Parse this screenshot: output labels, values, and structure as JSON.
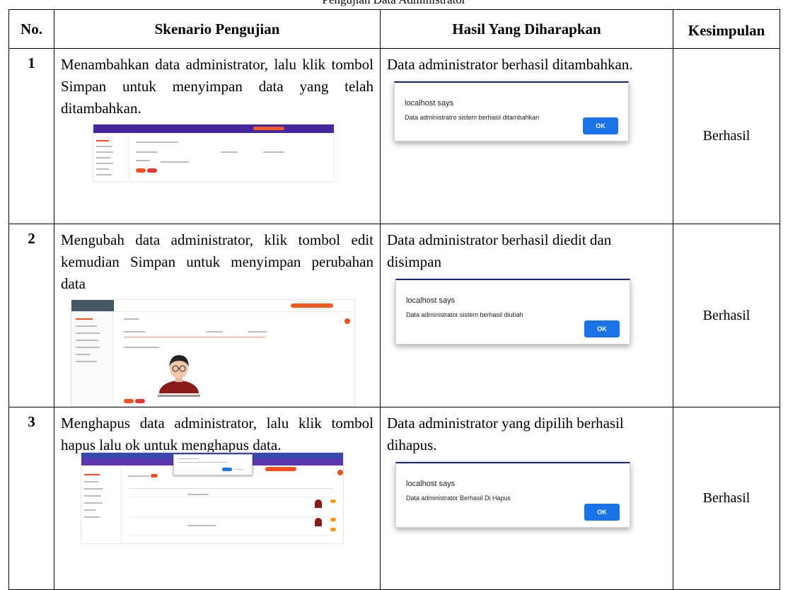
{
  "caption": "Pengujian Data Administrator",
  "headers": {
    "no": "No.",
    "scenario": "Skenario Pengujian",
    "expected": "Hasil Yang Diharapkan",
    "conclusion": "Kesimpulan"
  },
  "rows": [
    {
      "no": "1",
      "scenario": "Menambahkan data administrator, lalu klik tombol Simpan untuk menyimpan data yang telah ditambahkan.",
      "expected": "Data administrator berhasil ditambahkan.",
      "dialog_title": "localhost says",
      "dialog_message": "Data administratro sistem berhasil ditambahkan",
      "dialog_button": "OK",
      "conclusion": "Berhasil"
    },
    {
      "no": "2",
      "scenario": "Mengubah data administrator, klik tombol edit kemudian Simpan untuk menyimpan perubahan data",
      "expected": "Data administrator berhasil diedit dan disimpan",
      "dialog_title": "localhost says",
      "dialog_message": "Data administrator sistem berhasil diubah",
      "dialog_button": "OK",
      "conclusion": "Berhasil"
    },
    {
      "no": "3",
      "scenario": "Menghapus data administrator, lalu klik tombol hapus lalu ok untuk menghapus data.",
      "expected": "Data administrator yang dipilih berhasil dihapus.",
      "dialog_title": "localhost says",
      "dialog_message": "Data administrator Berhasil Di Hapus",
      "dialog_button": "OK",
      "conclusion": "Berhasil"
    }
  ]
}
